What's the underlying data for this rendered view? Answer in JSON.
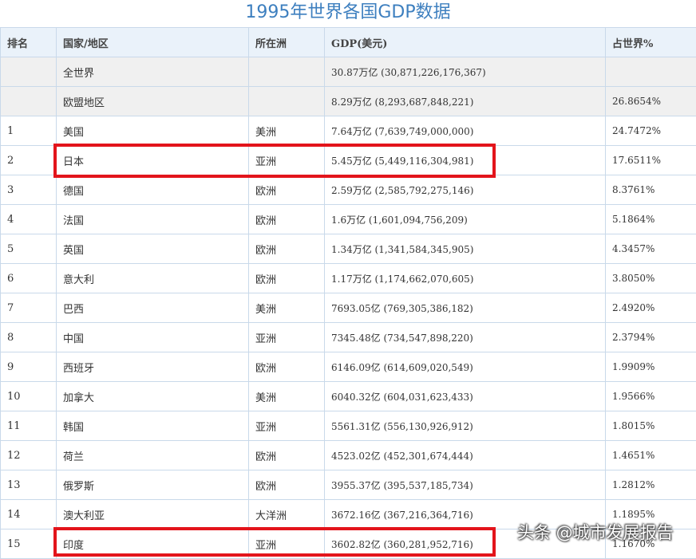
{
  "title": "1995年世界各国GDP数据",
  "columns": [
    "排名",
    "国家/地区",
    "所在洲",
    "GDP(美元)",
    "占世界%"
  ],
  "rows": [
    {
      "rank": "",
      "country": "全世界",
      "continent": "",
      "gdp": "30.87万亿 (30,871,226,176,367)",
      "share": ""
    },
    {
      "rank": "",
      "country": "欧盟地区",
      "continent": "",
      "gdp": "8.29万亿 (8,293,687,848,221)",
      "share": "26.8654%"
    },
    {
      "rank": "1",
      "country": "美国",
      "continent": "美洲",
      "gdp": "7.64万亿 (7,639,749,000,000)",
      "share": "24.7472%"
    },
    {
      "rank": "2",
      "country": "日本",
      "continent": "亚洲",
      "gdp": "5.45万亿 (5,449,116,304,981)",
      "share": "17.6511%"
    },
    {
      "rank": "3",
      "country": "德国",
      "continent": "欧洲",
      "gdp": "2.59万亿 (2,585,792,275,146)",
      "share": "8.3761%"
    },
    {
      "rank": "4",
      "country": "法国",
      "continent": "欧洲",
      "gdp": "1.6万亿 (1,601,094,756,209)",
      "share": "5.1864%"
    },
    {
      "rank": "5",
      "country": "英国",
      "continent": "欧洲",
      "gdp": "1.34万亿 (1,341,584,345,905)",
      "share": "4.3457%"
    },
    {
      "rank": "6",
      "country": "意大利",
      "continent": "欧洲",
      "gdp": "1.17万亿 (1,174,662,070,605)",
      "share": "3.8050%"
    },
    {
      "rank": "7",
      "country": "巴西",
      "continent": "美洲",
      "gdp": "7693.05亿 (769,305,386,182)",
      "share": "2.4920%"
    },
    {
      "rank": "8",
      "country": "中国",
      "continent": "亚洲",
      "gdp": "7345.48亿 (734,547,898,220)",
      "share": "2.3794%"
    },
    {
      "rank": "9",
      "country": "西班牙",
      "continent": "欧洲",
      "gdp": "6146.09亿 (614,609,020,549)",
      "share": "1.9909%"
    },
    {
      "rank": "10",
      "country": "加拿大",
      "continent": "美洲",
      "gdp": "6040.32亿 (604,031,623,433)",
      "share": "1.9566%"
    },
    {
      "rank": "11",
      "country": "韩国",
      "continent": "亚洲",
      "gdp": "5561.31亿 (556,130,926,912)",
      "share": "1.8015%"
    },
    {
      "rank": "12",
      "country": "荷兰",
      "continent": "欧洲",
      "gdp": "4523.02亿 (452,301,674,444)",
      "share": "1.4651%"
    },
    {
      "rank": "13",
      "country": "俄罗斯",
      "continent": "欧洲",
      "gdp": "3955.37亿 (395,537,185,734)",
      "share": "1.2812%"
    },
    {
      "rank": "14",
      "country": "澳大利亚",
      "continent": "大洋洲",
      "gdp": "3672.16亿 (367,216,364,716)",
      "share": "1.1895%"
    },
    {
      "rank": "15",
      "country": "印度",
      "continent": "亚洲",
      "gdp": "3602.82亿 (360,281,952,716)",
      "share": "1.1670%"
    }
  ],
  "highlighted_countries": [
    "日本",
    "印度"
  ],
  "highlight_color": "#e3141b",
  "watermark": "头条 @城市发展报告"
}
